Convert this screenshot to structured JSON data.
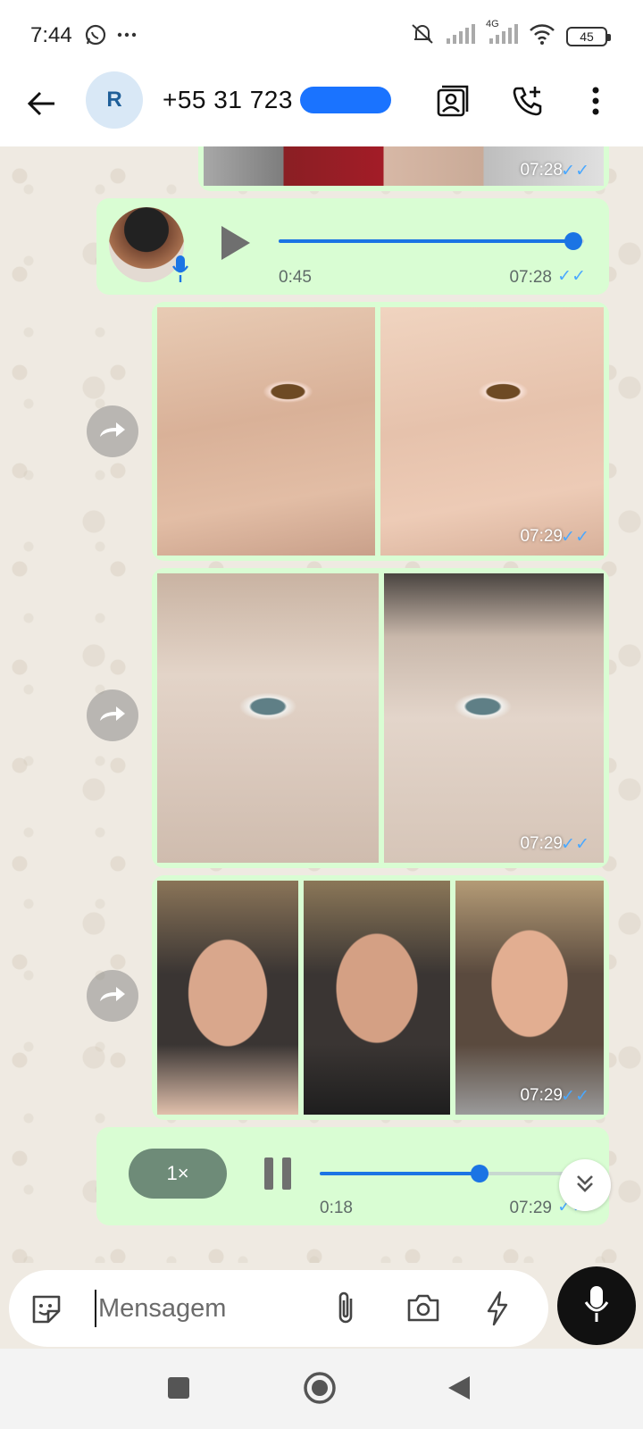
{
  "status_bar": {
    "time": "7:44",
    "network_label": "4G",
    "battery": "45",
    "icons": [
      "whatsapp-icon",
      "more-dots-icon",
      "mute-icon",
      "signal-icon",
      "signal-4g-icon",
      "wifi-icon",
      "battery-icon"
    ]
  },
  "header": {
    "avatar_initial": "R",
    "contact_name": "+55 31 723",
    "icons": [
      "back-arrow-icon",
      "contact-card-icon",
      "add-call-icon",
      "more-vert-icon"
    ]
  },
  "messages": [
    {
      "type": "image",
      "time": "07:28",
      "status": "read"
    },
    {
      "type": "audio",
      "duration": "0:45",
      "time": "07:28",
      "status": "read",
      "progress": 1.0
    },
    {
      "type": "image",
      "time": "07:29",
      "status": "read"
    },
    {
      "type": "image",
      "time": "07:29",
      "status": "read"
    },
    {
      "type": "image",
      "time": "07:29",
      "status": "read"
    },
    {
      "type": "audio",
      "speed": "1×",
      "position": "0:18",
      "time": "07:29",
      "status": "read",
      "progress": 0.6,
      "playing": true
    }
  ],
  "composer": {
    "placeholder": "Mensagem",
    "icons": [
      "sticker-icon",
      "attach-icon",
      "camera-icon",
      "bolt-icon",
      "mic-icon"
    ]
  },
  "colors": {
    "bubble": "#d9fdd3",
    "chat_bg": "#efeae2",
    "accent": "#1b74e4",
    "read_ticks": "#4aa8ff"
  }
}
